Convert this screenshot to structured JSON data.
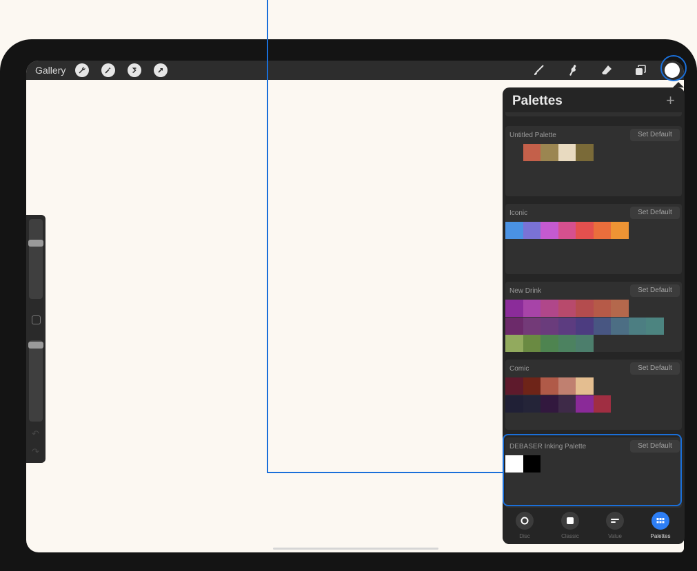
{
  "toolbar": {
    "gallery_label": "Gallery",
    "left_icons": [
      "wrench-icon",
      "magic-wand-icon",
      "selection-icon",
      "transform-arrow-icon"
    ],
    "right_icons": [
      "brush-icon",
      "smudge-icon",
      "eraser-icon",
      "layers-icon"
    ],
    "current_color": "#ffffff"
  },
  "accent_color": "#1a6fd9",
  "panel": {
    "title": "Palettes",
    "add_label": "+",
    "set_default_label": "Set Default",
    "palettes": [
      {
        "name": "Untitled Palette",
        "rows": [
          [
            "transparent",
            "#c4604a",
            "#9b8651",
            "#e8dac0",
            "#7a6a38"
          ]
        ]
      },
      {
        "name": "Iconic",
        "rows": [
          [
            "#4a92e4",
            "#7a72d6",
            "#c45ad0",
            "#d6508e",
            "#e4504e",
            "#ea6e3c",
            "#ee9434"
          ]
        ]
      },
      {
        "name": "New Drink",
        "rows": [
          [
            "#8b2c9a",
            "#a744a8",
            "#b0478a",
            "#b84a6c",
            "#b44c4e",
            "#b65a48",
            "#b4684c"
          ],
          [
            "#6c2a6a",
            "#733a78",
            "#6a3c7c",
            "#5c3c80",
            "#4c3c80",
            "#485682",
            "#4c6e84",
            "#4c7e82",
            "#4c8480"
          ],
          [
            "#92aa5e",
            "#6a8a42",
            "#4e8450",
            "#4c8260",
            "#4c7e6c"
          ]
        ]
      },
      {
        "name": "Comic",
        "rows": [
          [
            "#5e1a2c",
            "#6e2418",
            "#b05a48",
            "#c08070",
            "#e4be90"
          ],
          [
            "#202036",
            "#242438",
            "#32183e",
            "#3e2a48",
            "#8a2a98",
            "#a02e42"
          ]
        ]
      },
      {
        "name": "DEBASER Inking Palette",
        "rows": [
          [
            "#ffffff",
            "#000000"
          ]
        ]
      }
    ],
    "tabs": [
      {
        "label": "Disc",
        "icon": "disc-icon",
        "active": false
      },
      {
        "label": "Classic",
        "icon": "classic-square-icon",
        "active": false
      },
      {
        "label": "Value",
        "icon": "value-sliders-icon",
        "active": false
      },
      {
        "label": "Palettes",
        "icon": "palettes-grid-icon",
        "active": true
      }
    ]
  }
}
